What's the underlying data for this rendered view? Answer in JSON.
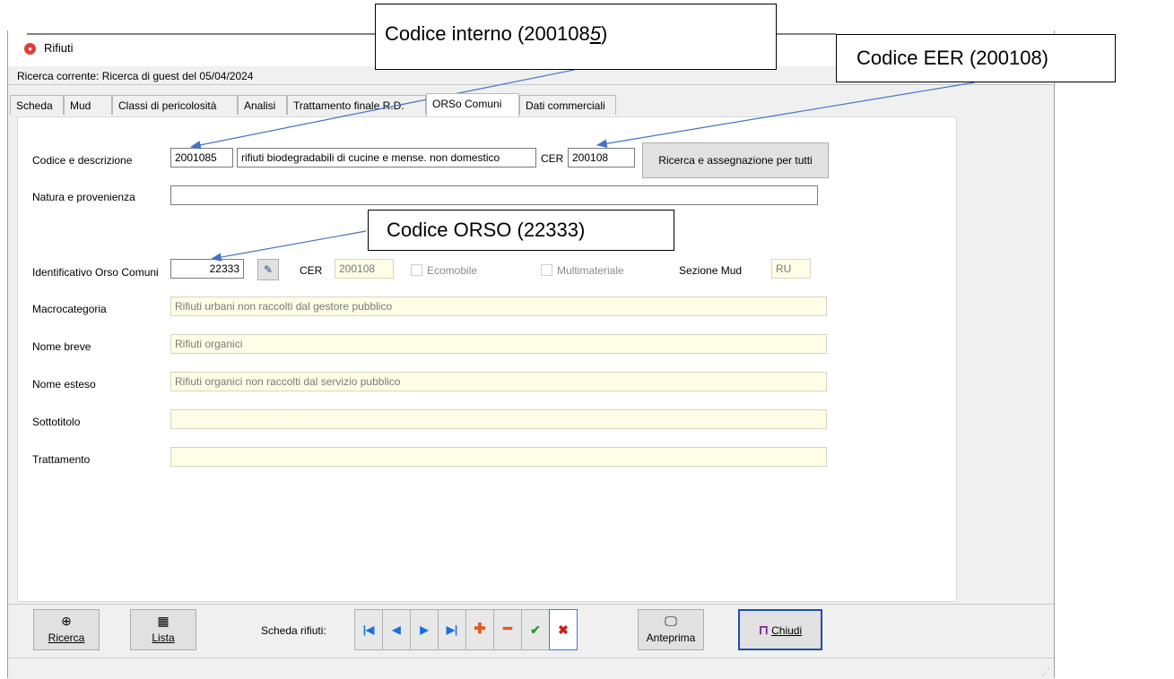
{
  "window": {
    "title": "Rifiuti",
    "search_line": "Ricerca corrente: Ricerca di guest del 05/04/2024"
  },
  "tabs": [
    {
      "label": "Scheda"
    },
    {
      "label": "Mud"
    },
    {
      "label": "Classi di pericolosità"
    },
    {
      "label": "Analisi"
    },
    {
      "label": "Trattamento finale R.D."
    },
    {
      "label": "ORSo Comuni"
    },
    {
      "label": "Dati commerciali"
    }
  ],
  "active_tab": "ORSo Comuni",
  "form": {
    "codice_label": "Codice e descrizione",
    "codice_value": "2001085",
    "descrizione_value": "rifiuti biodegradabili di cucine e mense. non domestico",
    "cer_label": "CER",
    "cer_value": "200108",
    "assign_button": "Ricerca e assegnazione per tutti",
    "natura_label": "Natura e provenienza",
    "natura_value": "",
    "orso_label": "Identificativo Orso Comuni",
    "orso_value": "22333",
    "cer2_label": "CER",
    "cer2_value": "200108",
    "ecomobile_label": "Ecomobile",
    "multimateriale_label": "Multimateriale",
    "sezione_label": "Sezione Mud",
    "sezione_value": "RU",
    "macro_label": "Macrocategoria",
    "macro_value": "Rifiuti urbani non raccolti dal gestore pubblico",
    "nome_breve_label": "Nome breve",
    "nome_breve_value": "Rifiuti organici",
    "nome_esteso_label": "Nome esteso",
    "nome_esteso_value": "Rifiuti organici non raccolti dal servizio pubblico",
    "sottotitolo_label": "Sottotitolo",
    "sottotitolo_value": "",
    "trattamento_label": "Trattamento",
    "trattamento_value": ""
  },
  "toolbar": {
    "ricerca_label": "Ricerca",
    "lista_label": "Lista",
    "scheda_label": "Scheda rifiuti:",
    "anteprima_label": "Anteprima",
    "chiudi_label": "Chiudi",
    "colors": {
      "nav": "#1a6fe0",
      "add": "#e55a1c",
      "remove": "#e55a1c",
      "confirm": "#2a9a2a",
      "cancel": "#d21c1c"
    }
  },
  "callouts": {
    "interno_prefix": "Codice interno (200108",
    "interno_digit": "5",
    "interno_suffix": ")",
    "eer": "Codice EER (200108)",
    "orso": "Codice ORSO (22333)",
    "arrow_color": "#4472c4"
  }
}
